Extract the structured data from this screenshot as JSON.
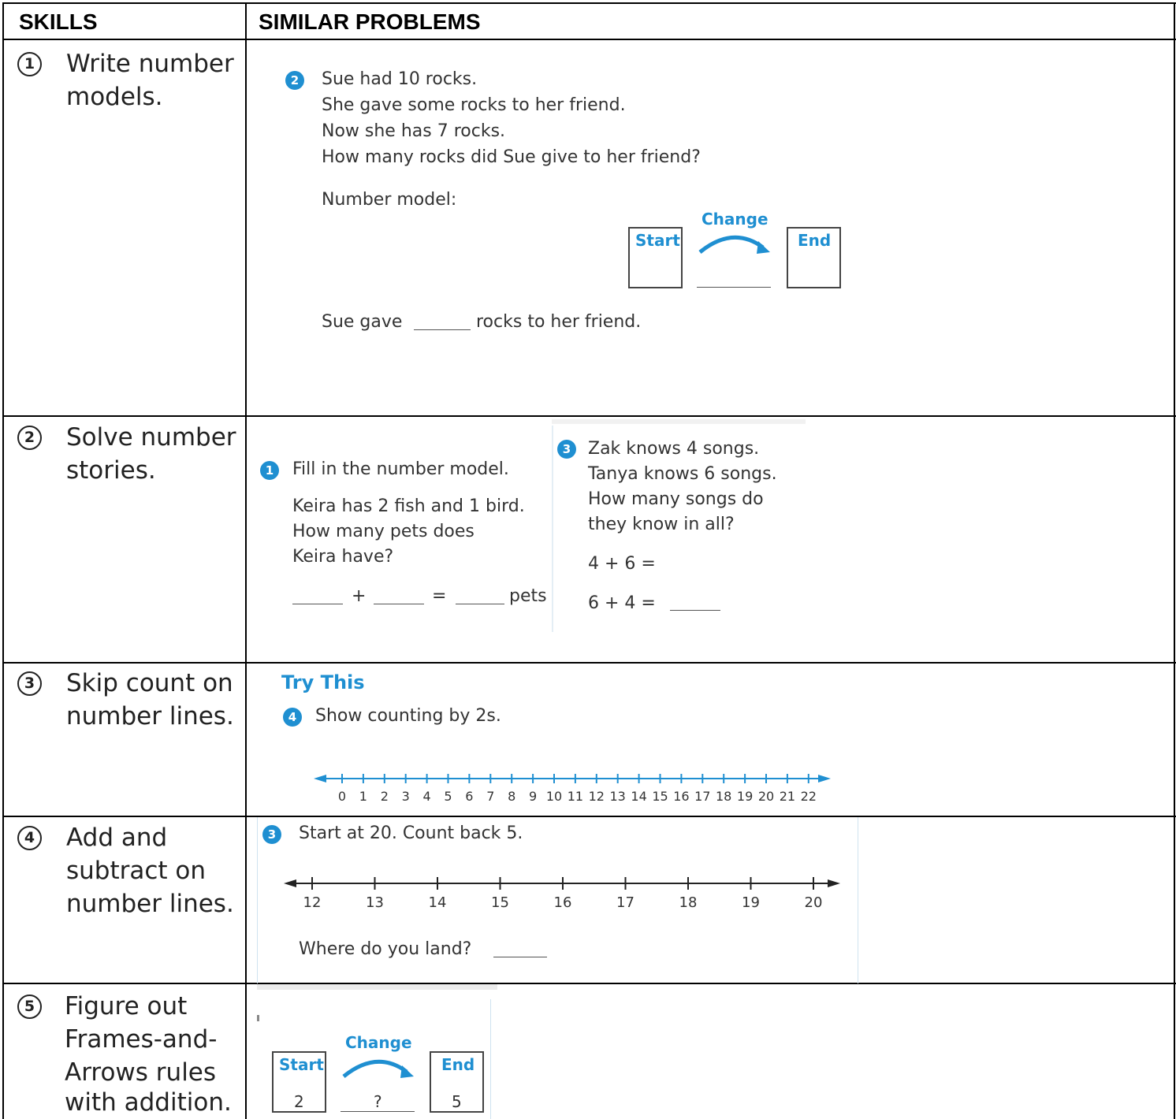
{
  "headers": {
    "skills": "SKILLS",
    "similar": "SIMILAR PROBLEMS"
  },
  "skills": [
    {
      "num": "1",
      "lines": [
        "Write number",
        "models."
      ]
    },
    {
      "num": "2",
      "lines": [
        "Solve number",
        "stories."
      ]
    },
    {
      "num": "3",
      "lines": [
        "Skip count on",
        "number lines."
      ]
    },
    {
      "num": "4",
      "lines": [
        "Add and",
        "subtract on",
        "number lines."
      ]
    },
    {
      "num": "5",
      "lines": [
        "Figure out",
        "Frames-and-",
        "Arrows rules",
        "with addition."
      ]
    }
  ],
  "row1": {
    "badge": "2",
    "lines": [
      "Sue had 10 rocks.",
      "She gave some rocks to her friend.",
      "Now she has 7 rocks.",
      "How many rocks did Sue give to her friend?"
    ],
    "number_model": "Number model:",
    "start": "Start",
    "change": "Change",
    "end": "End",
    "answer_pre": "Sue gave",
    "answer_post": "rocks to her friend."
  },
  "row2": {
    "left": {
      "badge": "1",
      "instruction": "Fill in the number model.",
      "lines": [
        "Keira has 2 fish and 1 bird.",
        "How many pets does",
        "Keira have?"
      ],
      "plus": "+",
      "equals": "=",
      "unit": "pets"
    },
    "right": {
      "badge": "3",
      "lines": [
        "Zak knows 4 songs.",
        "Tanya knows 6 songs.",
        "How many songs do",
        "they know in all?"
      ],
      "eq1": "4 + 6 =",
      "eq2": "6 + 4 ="
    }
  },
  "row3": {
    "try_this": "Try This",
    "badge": "4",
    "instruction": "Show counting by 2s.",
    "ticks": [
      "0",
      "1",
      "2",
      "3",
      "4",
      "5",
      "6",
      "7",
      "8",
      "9",
      "10",
      "11",
      "12",
      "13",
      "14",
      "15",
      "16",
      "17",
      "18",
      "19",
      "20",
      "21",
      "22"
    ]
  },
  "row4": {
    "badge": "3",
    "instruction": "Start at 20. Count back 5.",
    "ticks": [
      "12",
      "13",
      "14",
      "15",
      "16",
      "17",
      "18",
      "19",
      "20"
    ],
    "question": "Where do you land?"
  },
  "row5": {
    "start": "Start",
    "change": "Change",
    "end": "End",
    "start_val": "2",
    "change_val": "?",
    "end_val": "5"
  },
  "colors": {
    "accent": "#1f8fd1",
    "border": "#000000"
  }
}
